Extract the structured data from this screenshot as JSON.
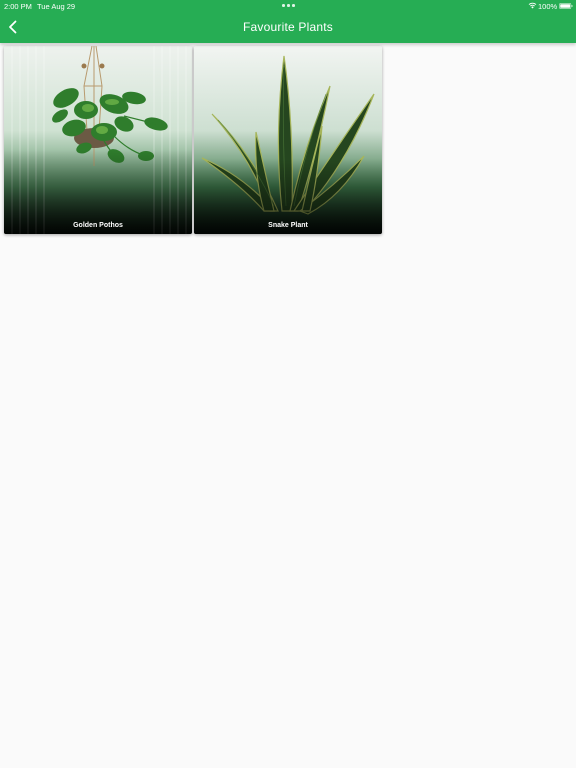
{
  "status_bar": {
    "time": "2:00 PM",
    "date": "Tue Aug 29",
    "battery": "100%"
  },
  "nav": {
    "title": "Favourite Plants",
    "back_icon": "chevron-left-icon"
  },
  "plants": [
    {
      "name": "Golden Pothos"
    },
    {
      "name": "Snake Plant"
    }
  ],
  "colors": {
    "header": "#26ad54",
    "background": "#fafafa"
  }
}
